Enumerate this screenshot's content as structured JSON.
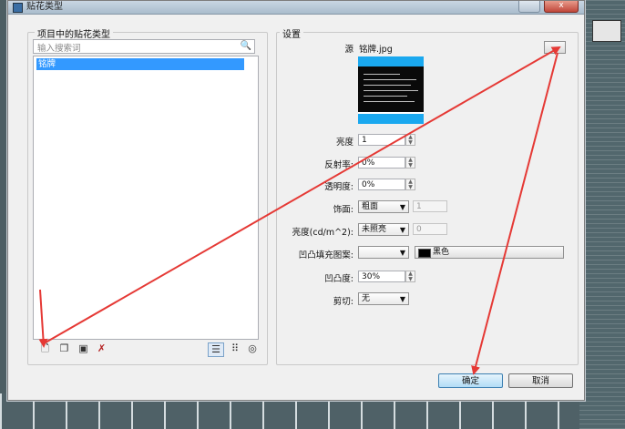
{
  "window": {
    "title": "贴花类型",
    "close_label": "x"
  },
  "left_panel": {
    "group_label": "项目中的贴花类型",
    "search_placeholder": "输入搜索词",
    "items": [
      {
        "label": "铭牌",
        "selected": true
      }
    ],
    "toolbar": [
      {
        "name": "new-icon",
        "glyph": "🗋"
      },
      {
        "name": "duplicate-icon",
        "glyph": "❐"
      },
      {
        "name": "rename-icon",
        "glyph": "▣"
      },
      {
        "name": "delete-icon",
        "glyph": "✗"
      }
    ],
    "view_modes": [
      {
        "name": "list-view-icon",
        "glyph": "☰",
        "active": true
      },
      {
        "name": "small-icons-view-icon",
        "glyph": "⠿",
        "active": false
      },
      {
        "name": "large-icons-view-icon",
        "glyph": "◎",
        "active": false
      }
    ]
  },
  "settings": {
    "group_label": "设置",
    "source_label": "源",
    "source_value": "铭牌.jpg",
    "browse_label": "...",
    "brightness_label": "亮度",
    "brightness_value": "1",
    "reflectivity_label": "反射率:",
    "reflectivity_value": "0%",
    "transparency_label": "透明度:",
    "transparency_value": "0%",
    "finish_label": "饰面:",
    "finish_value": "粗面",
    "finish_extra": "1",
    "luminance_label": "亮度(cd/m^2):",
    "luminance_value": "未照亮",
    "luminance_extra": "0",
    "bump_pattern_label": "凹凸填充图案:",
    "bump_pattern_value": "",
    "bump_color_label": "黑色",
    "bump_amount_label": "凹凸度:",
    "bump_amount_value": "30%",
    "cutout_label": "剪切:",
    "cutout_value": "无"
  },
  "buttons": {
    "ok_label": "确定",
    "cancel_label": "取消"
  },
  "colors": {
    "selection": "#3399ff",
    "annotation_arrow": "#e53935",
    "preview_border": "#1aa8ef"
  }
}
